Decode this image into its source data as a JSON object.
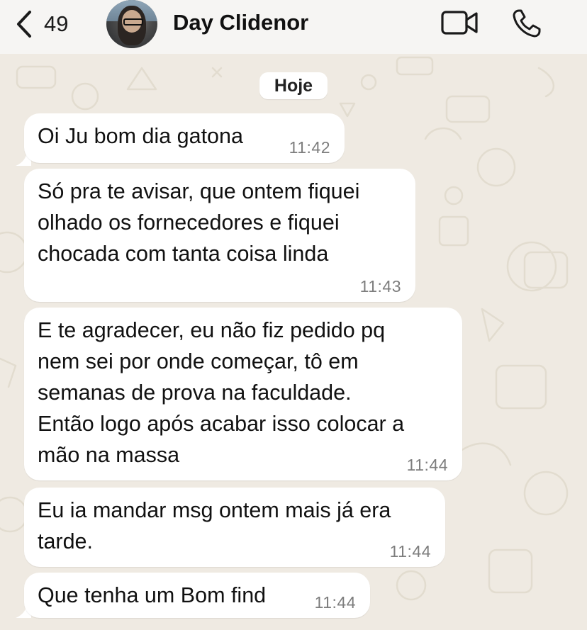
{
  "header": {
    "back_count": "49",
    "contact_name": "Day Clidenor",
    "icons": [
      "chevron-left-icon",
      "video-call-icon",
      "phone-icon"
    ]
  },
  "chat": {
    "date_label": "Hoje",
    "messages": [
      {
        "text": "Oi Ju bom dia gatona",
        "time": "11:42"
      },
      {
        "text": "Só pra te avisar, que ontem fiquei\nolhado os fornecedores e fiquei\nchocada com tanta coisa linda",
        "time": "11:43"
      },
      {
        "text": "E te agradecer, eu não fiz pedido pq\nnem sei por onde começar, tô em\nsemanas de prova na faculdade.\nEntão logo após acabar isso colocar a\nmão na massa",
        "time": "11:44"
      },
      {
        "text": "Eu ia mandar msg ontem mais já era\ntarde.",
        "time": "11:44"
      },
      {
        "text": "Que tenha um Bom find",
        "time": "11:44"
      }
    ]
  },
  "colors": {
    "header_bg": "#f6f5f3",
    "wallpaper_bg": "#efeae2",
    "bubble_bg": "#ffffff",
    "time_text": "#7d7d7d"
  }
}
